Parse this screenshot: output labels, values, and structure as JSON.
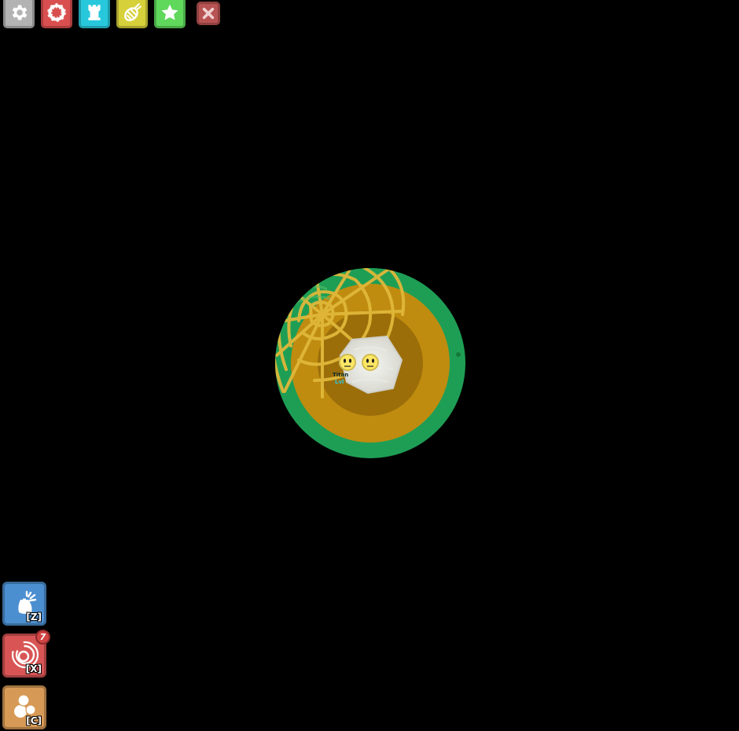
{
  "toolbar": {
    "buttons": [
      {
        "id": "settings",
        "icon": "gear-icon",
        "color": "#b3b3b3"
      },
      {
        "id": "petals",
        "icon": "ring-icon",
        "color": "#d94f4f"
      },
      {
        "id": "gallery",
        "icon": "rook-icon",
        "color": "#28c8dc"
      },
      {
        "id": "craft",
        "icon": "beetle-icon",
        "color": "#d6d03a"
      },
      {
        "id": "changelog",
        "icon": "star-icon",
        "color": "#5fd85b"
      },
      {
        "id": "close",
        "icon": "close-icon",
        "color": "#b85353"
      }
    ]
  },
  "abilities": [
    {
      "key": "[Z]",
      "icon": "bag-icon",
      "color": "#4c8fd0"
    },
    {
      "key": "[X]",
      "icon": "swirl-icon",
      "color": "#d95555",
      "badge": "7"
    },
    {
      "key": "[C]",
      "icon": "bubbles-icon",
      "color": "#d79a56"
    }
  ],
  "arena": {
    "outer_color": "#1e9e55",
    "inner_color": "#bf8c0f",
    "center_color": "#9c6e0a",
    "web_color": "#e0b83a",
    "players": [
      {
        "face": "neutral"
      },
      {
        "face": "neutral"
      }
    ],
    "mob": {
      "name": "Titan",
      "level": "Lvl"
    }
  }
}
